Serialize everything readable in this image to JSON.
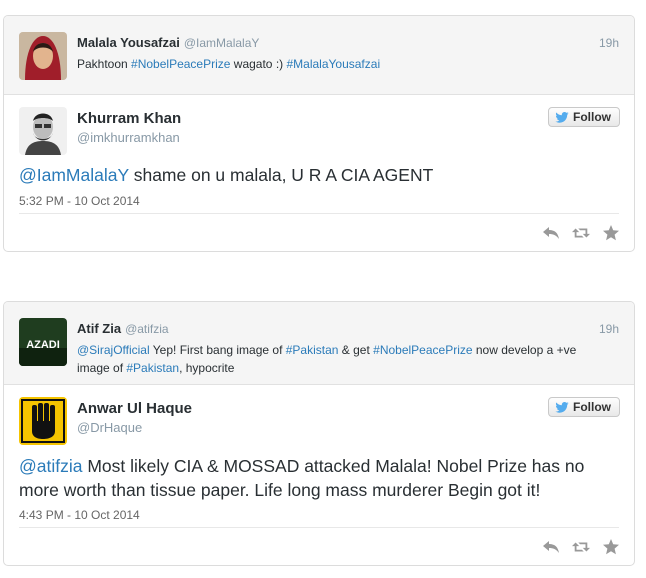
{
  "tweets": [
    {
      "parent": {
        "name": "Malala Yousafzai",
        "handle": "@IamMalalaY",
        "time": "19h",
        "text_parts": [
          "Pakhtoon ",
          "#NobelPeacePrize",
          " wagato :) ",
          "#MalalaYousafzai"
        ]
      },
      "main": {
        "name": "Khurram Khan",
        "handle": "@imkhurramkhan",
        "follow_label": "Follow",
        "mention": "@IamMalalaY",
        "text": " shame on u malala,  U R A CIA AGENT",
        "timestamp": "5:32 PM - 10 Oct 2014"
      }
    },
    {
      "parent": {
        "name": "Atif Zia",
        "handle": "@atifzia",
        "time": "19h",
        "avatar_text": "AZADI",
        "text_parts": [
          "@SirajOfficial",
          " Yep! First bang image of ",
          "#Pakistan",
          " & get ",
          "#NobelPeacePrize",
          " now develop a +ve image of ",
          "#Pakistan",
          ", hypocrite"
        ]
      },
      "main": {
        "name": "Anwar Ul Haque",
        "handle": "@DrHaque",
        "follow_label": "Follow",
        "mention": "@atifzia",
        "text": " Most likely CIA & MOSSAD attacked Malala! Nobel Prize has no more worth than tissue paper. Life long mass murderer Begin got it!",
        "timestamp": "4:43 PM - 10 Oct 2014"
      }
    }
  ],
  "colors": {
    "link": "#2b7bb9",
    "text": "#292f33",
    "muted": "#8899a6",
    "bird": "#55acee"
  }
}
